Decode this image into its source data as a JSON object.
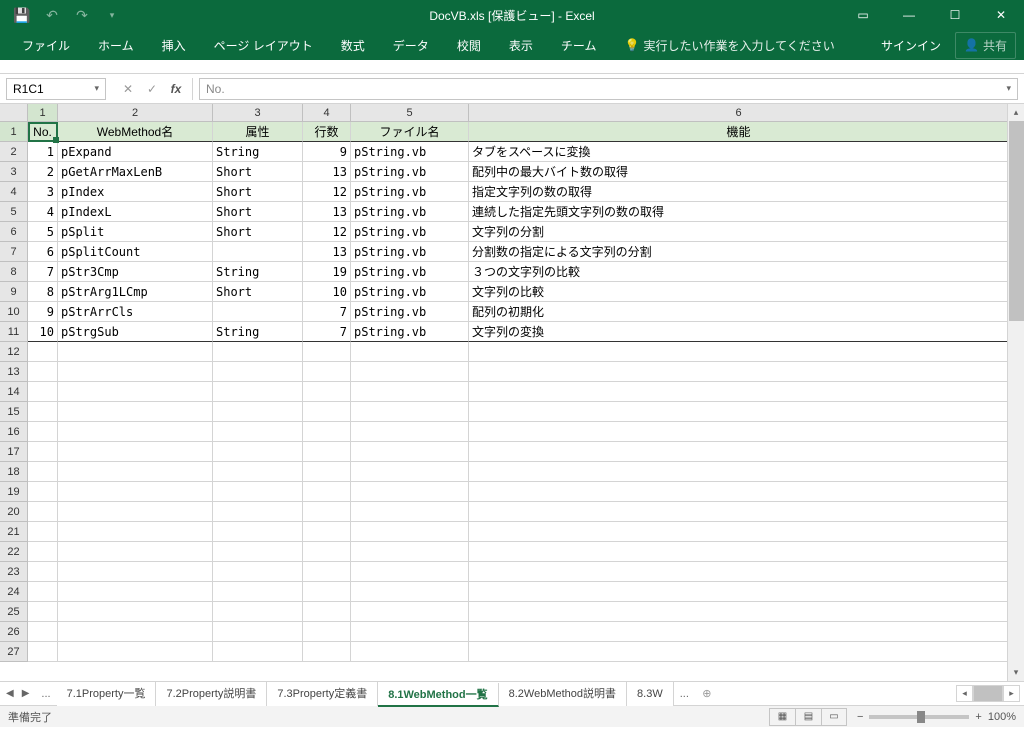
{
  "title": "DocVB.xls  [保護ビュー] - Excel",
  "ribbon": {
    "file": "ファイル",
    "home": "ホーム",
    "insert": "挿入",
    "layout": "ページ レイアウト",
    "formulas": "数式",
    "data": "データ",
    "review": "校閲",
    "view": "表示",
    "team": "チーム",
    "tellme": "実行したい作業を入力してください",
    "signin": "サインイン",
    "share": "共有"
  },
  "namebox": "R1C1",
  "formula": "No.",
  "col_headers": [
    "1",
    "2",
    "3",
    "4",
    "5",
    "6"
  ],
  "headers": {
    "no": "No.",
    "method": "WebMethod名",
    "attr": "属性",
    "lines": "行数",
    "file": "ファイル名",
    "func": "機能"
  },
  "rows": [
    {
      "no": "1",
      "method": "pExpand",
      "attr": "String",
      "lines": "9",
      "file": "pString.vb",
      "func": "タブをスペースに変換"
    },
    {
      "no": "2",
      "method": "pGetArrMaxLenB",
      "attr": "Short",
      "lines": "13",
      "file": "pString.vb",
      "func": "配列中の最大バイト数の取得"
    },
    {
      "no": "3",
      "method": "pIndex",
      "attr": "Short",
      "lines": "12",
      "file": "pString.vb",
      "func": "指定文字列の数の取得"
    },
    {
      "no": "4",
      "method": "pIndexL",
      "attr": "Short",
      "lines": "13",
      "file": "pString.vb",
      "func": "連続した指定先頭文字列の数の取得"
    },
    {
      "no": "5",
      "method": "pSplit",
      "attr": "Short",
      "lines": "12",
      "file": "pString.vb",
      "func": "文字列の分割"
    },
    {
      "no": "6",
      "method": "pSplitCount",
      "attr": "",
      "lines": "13",
      "file": "pString.vb",
      "func": "分割数の指定による文字列の分割"
    },
    {
      "no": "7",
      "method": "pStr3Cmp",
      "attr": "String",
      "lines": "19",
      "file": "pString.vb",
      "func": "３つの文字列の比較"
    },
    {
      "no": "8",
      "method": "pStrArg1LCmp",
      "attr": "Short",
      "lines": "10",
      "file": "pString.vb",
      "func": "文字列の比較"
    },
    {
      "no": "9",
      "method": "pStrArrCls",
      "attr": "",
      "lines": "7",
      "file": "pString.vb",
      "func": "配列の初期化"
    },
    {
      "no": "10",
      "method": "pStrgSub",
      "attr": "String",
      "lines": "7",
      "file": "pString.vb",
      "func": "文字列の変換"
    }
  ],
  "empty_rows": 16,
  "tabs": [
    "7.1Property一覧",
    "7.2Property説明書",
    "7.3Property定義書",
    "8.1WebMethod一覧",
    "8.2WebMethod説明書",
    "8.3W"
  ],
  "active_tab": 3,
  "status": "準備完了",
  "zoom": "100%"
}
